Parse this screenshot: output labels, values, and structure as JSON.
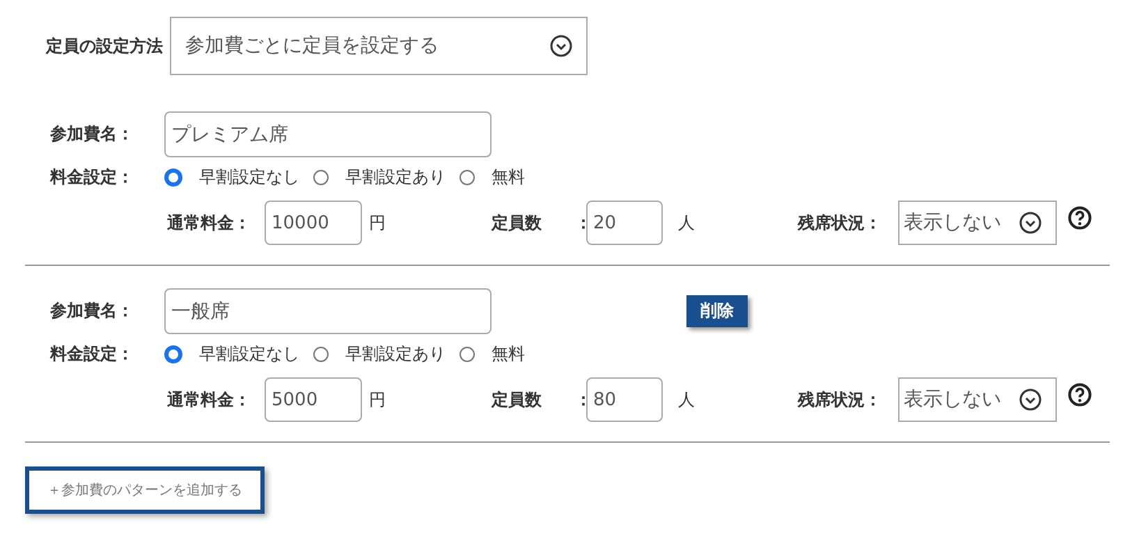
{
  "capacity_method": {
    "label": "定員の設定方法",
    "value": "参加費ごとに定員を設定する"
  },
  "fees": [
    {
      "name_label": "参加費名：",
      "name": "プレミアム席",
      "price_label": "料金設定：",
      "price_options": [
        {
          "label": "早割設定なし",
          "selected": true
        },
        {
          "label": "早割設定あり",
          "selected": false
        },
        {
          "label": "無料",
          "selected": false
        }
      ],
      "regular_label": "通常料金：",
      "regular_price": "10000",
      "currency": "円",
      "capacity_label": "定員数",
      "capacity_colon": "：",
      "capacity": "20",
      "capacity_unit": "人",
      "remaining_label": "残席状況：",
      "remaining_value": "表示しない"
    },
    {
      "name_label": "参加費名：",
      "name": "一般席",
      "delete_button": "削除",
      "price_label": "料金設定：",
      "price_options": [
        {
          "label": "早割設定なし",
          "selected": true
        },
        {
          "label": "早割設定あり",
          "selected": false
        },
        {
          "label": "無料",
          "selected": false
        }
      ],
      "regular_label": "通常料金：",
      "regular_price": "5000",
      "currency": "円",
      "capacity_label": "定員数",
      "capacity_colon": "：",
      "capacity": "80",
      "capacity_unit": "人",
      "remaining_label": "残席状況：",
      "remaining_value": "表示しない"
    }
  ],
  "add_button": "＋参加費のパターンを追加する"
}
